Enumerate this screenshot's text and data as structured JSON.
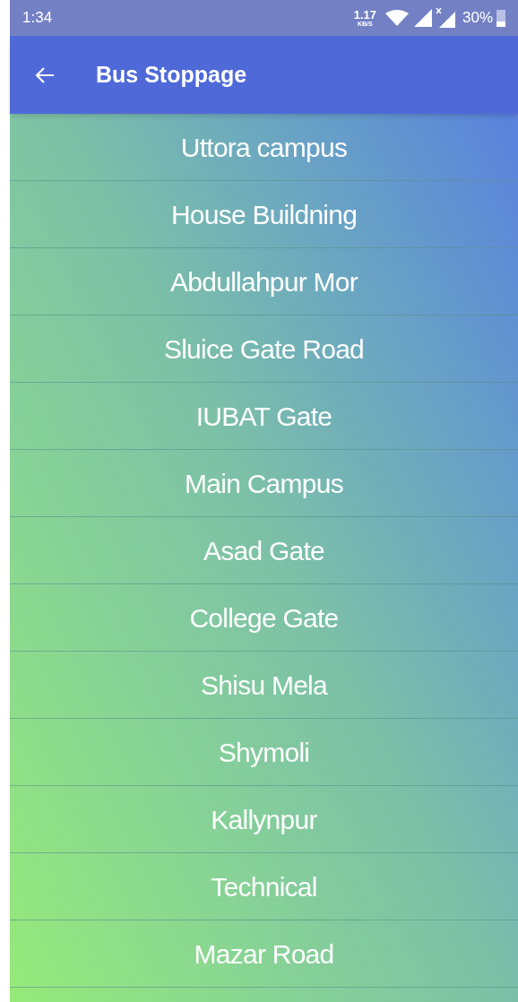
{
  "status_bar": {
    "time": "1:34",
    "speed_value": "1.17",
    "speed_unit": "KB/S",
    "battery": "30%"
  },
  "app_bar": {
    "title": "Bus Stoppage"
  },
  "stops": [
    "Uttora campus",
    "House Buildning",
    "Abdullahpur Mor",
    "Sluice Gate Road",
    "IUBAT Gate",
    "Main Campus",
    "Asad Gate",
    "College Gate",
    "Shisu Mela",
    "Shymoli",
    "Kallynpur",
    "Technical",
    "Mazar Road"
  ]
}
